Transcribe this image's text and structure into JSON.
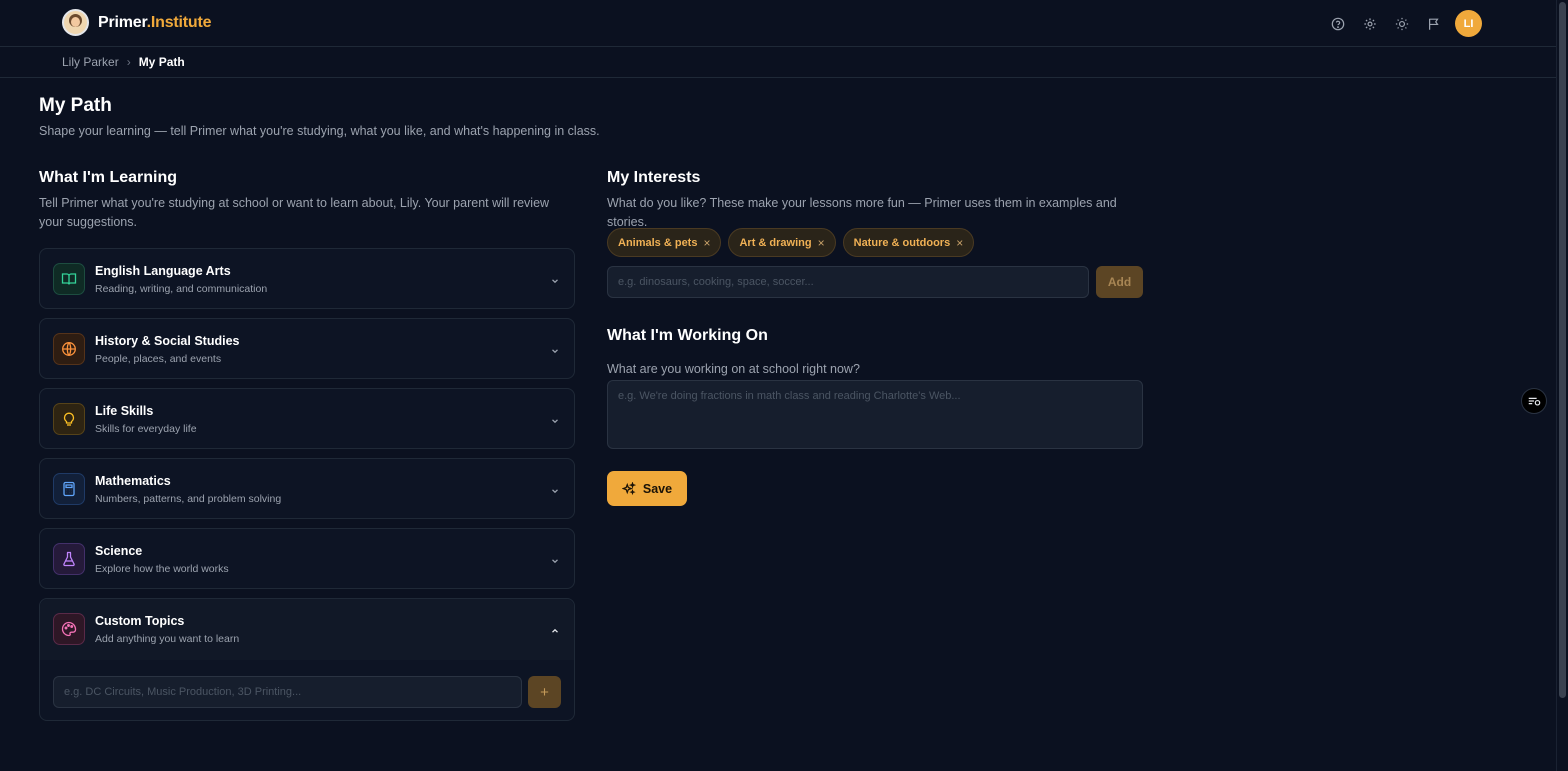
{
  "brand": {
    "name_part1": "Primer",
    "name_part2": ".Institute"
  },
  "topbar": {
    "icons": [
      "help-icon",
      "settings-icon",
      "theme-sun-icon",
      "flag-icon"
    ],
    "user_initials": "LI"
  },
  "breadcrumb": {
    "parent": "Lily Parker",
    "separator": "›",
    "current": "My Path"
  },
  "page": {
    "title": "My Path",
    "subtitle": "Shape your learning — tell Primer what you're studying, what you like, and what's happening in class."
  },
  "learning": {
    "title": "What I'm Learning",
    "description": "Tell Primer what you're studying at school or want to learn about, Lily. Your parent will review your suggestions.",
    "subjects": [
      {
        "name": "English Language Arts",
        "desc": "Reading, writing, and communication",
        "icon": "book-icon",
        "color": "#34d399"
      },
      {
        "name": "History & Social Studies",
        "desc": "People, places, and events",
        "icon": "globe-icon",
        "color": "#fb923c"
      },
      {
        "name": "Life Skills",
        "desc": "Skills for everyday life",
        "icon": "lightbulb-icon",
        "color": "#fbbf24"
      },
      {
        "name": "Mathematics",
        "desc": "Numbers, patterns, and problem solving",
        "icon": "calculator-icon",
        "color": "#60a5fa"
      },
      {
        "name": "Science",
        "desc": "Explore how the world works",
        "icon": "flask-icon",
        "color": "#c084fc"
      },
      {
        "name": "Custom Topics",
        "desc": "Add anything you want to learn",
        "icon": "palette-icon",
        "color": "#f472b6",
        "expanded": true
      }
    ],
    "custom_placeholder": "e.g. DC Circuits, Music Production, 3D Printing...",
    "custom_add_label": "+"
  },
  "interests": {
    "title": "My Interests",
    "description": "What do you like? These make your lessons more fun — Primer uses them in examples and stories.",
    "chips": [
      "Animals & pets",
      "Art & drawing",
      "Nature & outdoors"
    ],
    "chip_remove": "×",
    "input_placeholder": "e.g. dinosaurs, cooking, space, soccer...",
    "add_label": "Add"
  },
  "working_on": {
    "title": "What I'm Working On",
    "description": "What are you working on at school right now?",
    "placeholder": "e.g. We're doing fractions in math class and reading Charlotte's Web..."
  },
  "save_label": "Save",
  "colors": {
    "accent": "#f0a93b",
    "background": "#0b1120"
  }
}
